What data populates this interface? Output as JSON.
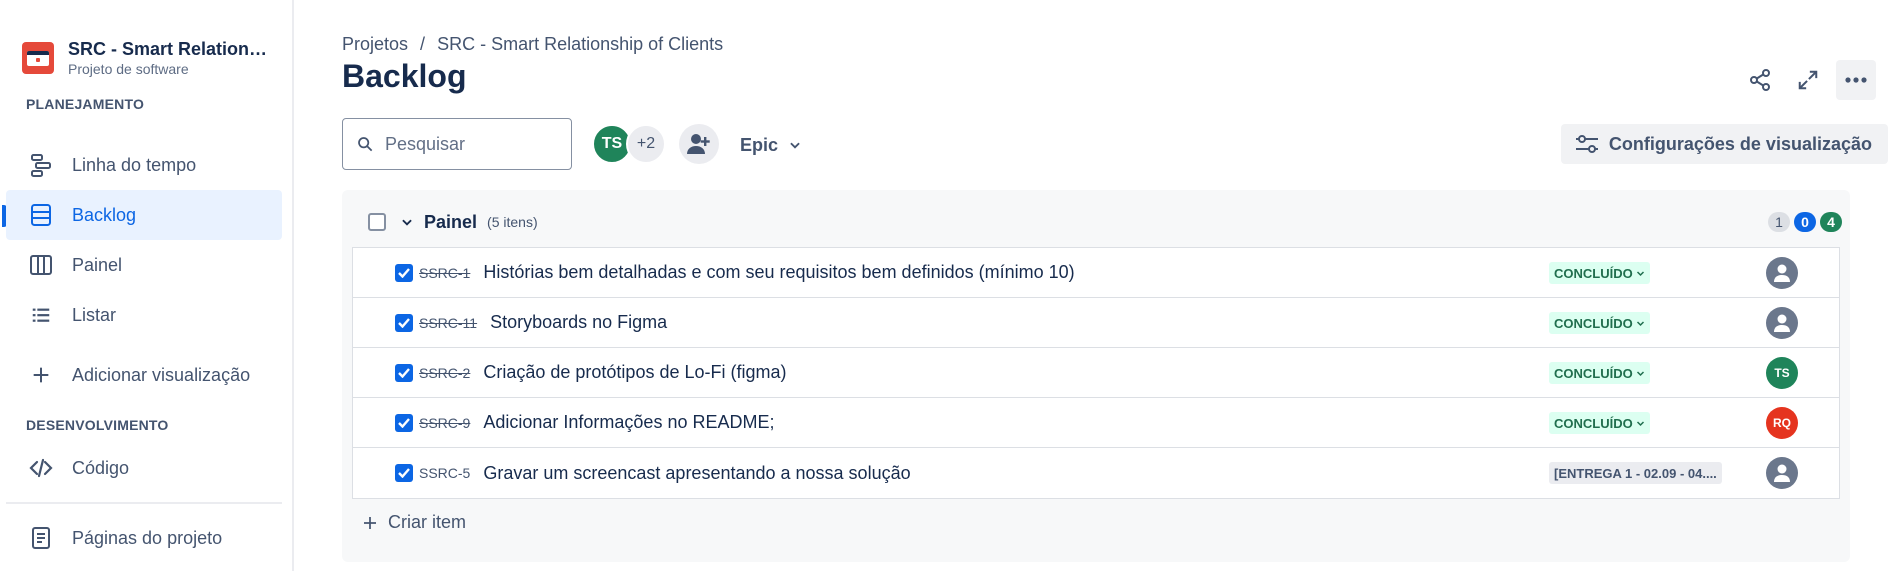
{
  "project": {
    "name": "SRC - Smart Relationship of Clients",
    "type": "Projeto de software"
  },
  "sidebar": {
    "planning_title": "PLANEJAMENTO",
    "dev_title": "DESENVOLVIMENTO",
    "items": [
      {
        "label": "Linha do tempo",
        "icon": "timeline-icon"
      },
      {
        "label": "Backlog",
        "icon": "backlog-icon",
        "active": true
      },
      {
        "label": "Painel",
        "icon": "board-icon"
      },
      {
        "label": "Listar",
        "icon": "list-icon"
      },
      {
        "label": "Adicionar visualização",
        "icon": "plus-icon"
      },
      {
        "label": "Código",
        "icon": "code-icon"
      },
      {
        "label": "Páginas do projeto",
        "icon": "pages-icon"
      }
    ]
  },
  "header": {
    "breadcrumb": [
      "Projetos",
      "/",
      "SRC - Smart Relationship of Clients"
    ],
    "title": "Backlog"
  },
  "toolbar": {
    "search_placeholder": "Pesquisar",
    "avatar_initials": "TS",
    "avatar_more": "+2",
    "epic_label": "Epic",
    "view_settings_label": "Configurações de visualização"
  },
  "board": {
    "name": "Painel",
    "count_label": "(5 itens)",
    "counts": {
      "todo": "1",
      "in_progress": "0",
      "done": "4"
    },
    "issues": [
      {
        "key": "SSRC-1",
        "summary": "Histórias bem detalhadas e com seu requisitos bem definidos (mínimo 10)",
        "status": "CONCLUÍDO",
        "assignee": ""
      },
      {
        "key": "SSRC-11",
        "summary": "Storyboards no Figma",
        "status": "CONCLUÍDO",
        "assignee": ""
      },
      {
        "key": "SSRC-2",
        "summary": "Criação de protótipos de Lo-Fi (figma)",
        "status": "CONCLUÍDO",
        "assignee": "TS"
      },
      {
        "key": "SSRC-9",
        "summary": "Adicionar Informações no README;",
        "status": "CONCLUÍDO",
        "assignee": "RQ"
      },
      {
        "key": "SSRC-5",
        "summary": "Gravar um screencast apresentando a nossa solução",
        "status": "[ENTREGA 1 - 02.09 - 04....",
        "assignee": ""
      }
    ],
    "create_label": "Criar item"
  },
  "colors": {
    "accent": "#0c66e4",
    "project_logo": "#e5493a",
    "done_bg": "#dcfff1",
    "done_text": "#216e4e",
    "avatar_ts": "#1f845a",
    "avatar_rq": "#e5341f"
  }
}
